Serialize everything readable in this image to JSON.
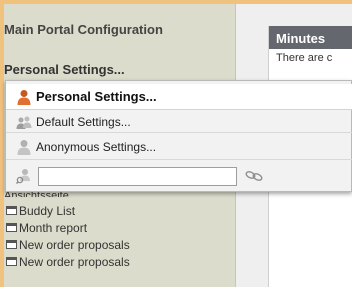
{
  "left_column": {
    "portal_title": "Main Portal Configuration",
    "personal_heading": "Personal Settings...",
    "partial_item": "Ansichtsseite",
    "list_items": [
      "Buddy List",
      "Month report",
      "New order proposals",
      "New order proposals"
    ]
  },
  "minutes_portlet": {
    "title": "Minutes",
    "text": "There are c"
  },
  "settings_menu": {
    "personal": "Personal Settings...",
    "default": "Default Settings...",
    "anonymous": "Anonymous Settings...",
    "search_value": ""
  },
  "icons": {
    "personal": "user-orange-icon",
    "default": "users-gray-icon",
    "anonymous": "user-gray-icon",
    "search_user": "user-search-icon",
    "link": "chain-link-icon",
    "list_item": "window-icon"
  },
  "colors": {
    "frame_accent": "#f1c27d",
    "left_panel_bg": "#dcdccc",
    "portlet_header_bg": "#64676e",
    "menu_bg": "#f2f2f2"
  }
}
